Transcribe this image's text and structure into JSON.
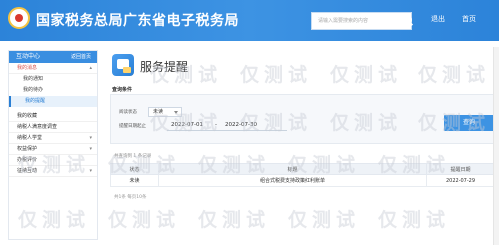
{
  "header": {
    "site_title": "国家税务总局广东省电子税务局",
    "search_placeholder": "请输入需要搜索的内容",
    "link_user": "退出",
    "link_home": "首页"
  },
  "sidebar": {
    "title": "互动中心",
    "title_link": "返回首页",
    "items": [
      {
        "label": "我的消息",
        "expanded": true,
        "children": [
          {
            "label": "我的通知"
          },
          {
            "label": "我的待办"
          },
          {
            "label": "我的提醒",
            "active": true
          }
        ]
      },
      {
        "label": "我的收藏"
      },
      {
        "label": "纳税人满意度调查"
      },
      {
        "label": "纳税人学堂"
      },
      {
        "label": "权益保护"
      },
      {
        "label": "办税评价"
      },
      {
        "label": "征纳互动"
      }
    ]
  },
  "main": {
    "page_title": "服务提醒",
    "query_section_label": "查询条件",
    "status_label": "阅读状态",
    "status_value": "未读",
    "date_label": "提醒日期起止",
    "date_from": "2022-07-01",
    "date_to": "2022-07-30",
    "date_dash": "-",
    "query_button": "查询",
    "result_info": "共查询到 1 条记录",
    "table": {
      "headers": [
        "状态",
        "标题",
        "提醒日期"
      ],
      "rows": [
        {
          "status": "未读",
          "subject": "组合式税费支持政策红利账单",
          "date": "2022-07-29"
        }
      ]
    },
    "pager_text": "共1条 每页10条"
  },
  "watermark": {
    "text": "仅测试"
  },
  "colors": {
    "header": "#2c83d9",
    "accent": "#3d93e3",
    "active_text": "#d9534f"
  }
}
